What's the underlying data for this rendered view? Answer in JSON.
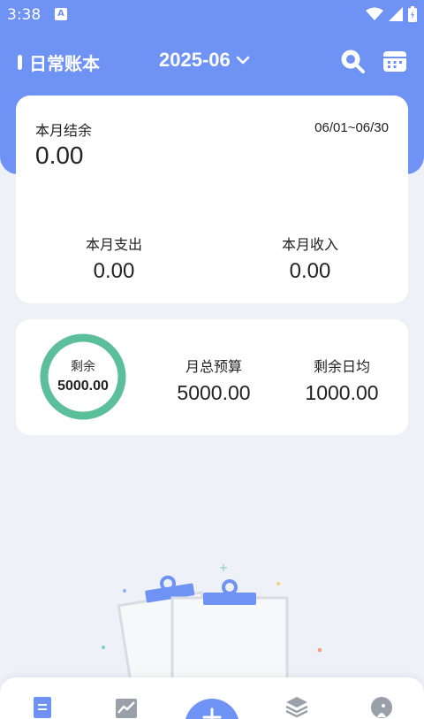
{
  "status_bar": {
    "time": "3:38",
    "notification_badge": "A"
  },
  "app_bar": {
    "title": "日常账本",
    "month": "2025-06",
    "icons": [
      "search-icon",
      "calendar-icon"
    ]
  },
  "summary": {
    "balance_label": "本月结余",
    "balance_value": "0.00",
    "date_range": "06/01~06/30",
    "expense_label": "本月支出",
    "expense_value": "0.00",
    "income_label": "本月收入",
    "income_value": "0.00"
  },
  "budget": {
    "remaining_label": "剩余",
    "remaining_value": "5000.00",
    "remaining_fraction": 1.0,
    "total_label": "月总预算",
    "total_value": "5000.00",
    "daily_label": "剩余日均",
    "daily_value": "1000.00"
  },
  "bottom_nav": {
    "items": [
      "ledger-icon",
      "chart-icon",
      "add-icon",
      "layers-icon",
      "profile-icon"
    ]
  },
  "colors": {
    "primary": "#6f93f5",
    "ring": "#5cbf9b",
    "background": "#eef1f7"
  }
}
